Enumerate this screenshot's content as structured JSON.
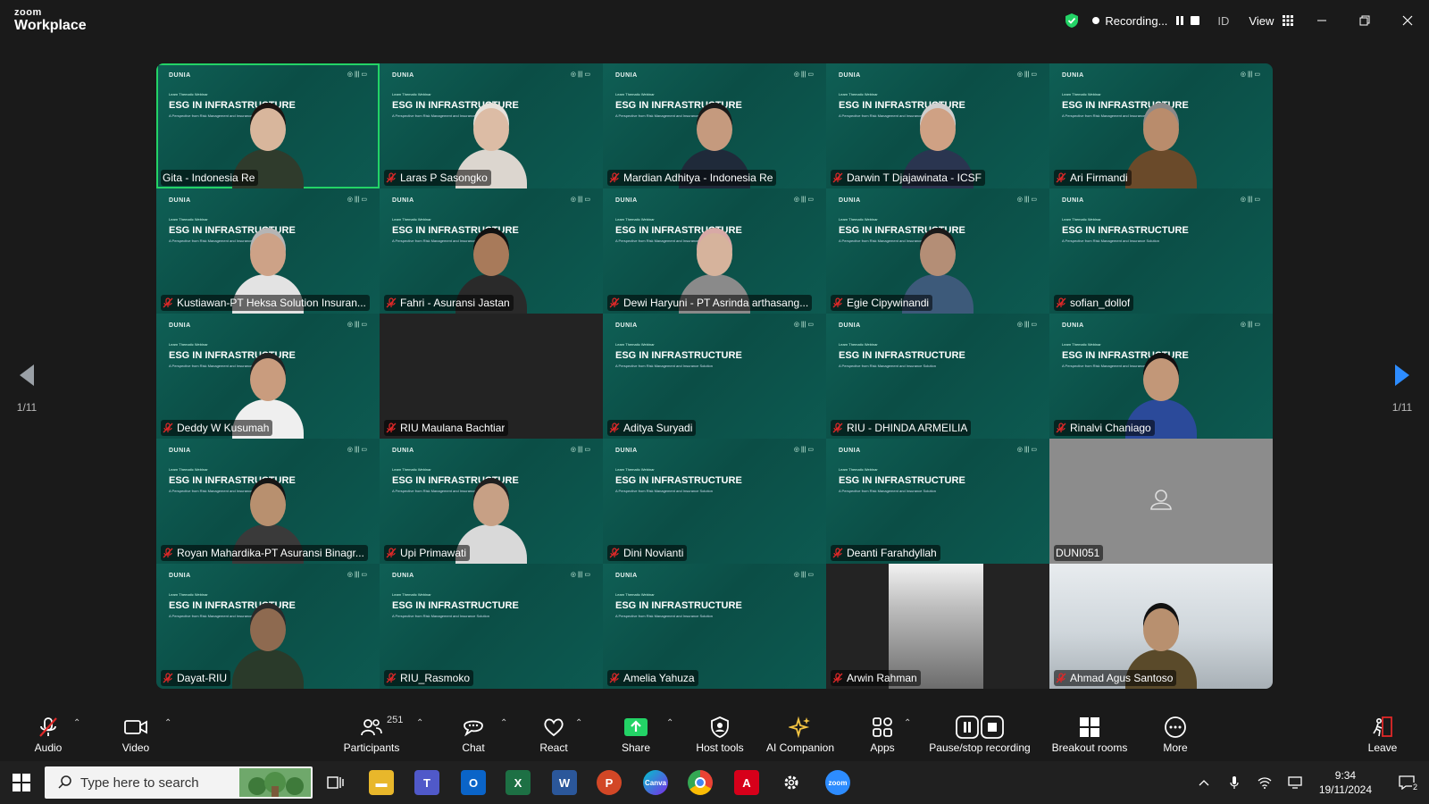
{
  "window": {
    "brand_top": "zoom",
    "brand_bottom": "Workplace",
    "recording_label": "Recording...",
    "id_label": "ID",
    "view_label": "View"
  },
  "gallery": {
    "page_left": "1/11",
    "page_right": "1/11"
  },
  "slide": {
    "brand": "DUNIA",
    "logos": "◎ ||| ▭",
    "kicker": "Learn Thematic Webinar",
    "title": "ESG IN INFRASTRUCTURE",
    "subtitle": "A Perspective from Risk Management and Insurance Solution"
  },
  "participants": [
    {
      "name": "Gita - Indonesia Re",
      "muted": false
    },
    {
      "name": "Laras P Sasongko",
      "muted": true
    },
    {
      "name": "Mardian Adhitya - Indonesia Re",
      "muted": true
    },
    {
      "name": "Darwin T Djajawinata - ICSF",
      "muted": true
    },
    {
      "name": "Ari Firmandi",
      "muted": true
    },
    {
      "name": "Kustiawan-PT Heksa Solution Insuran...",
      "muted": true
    },
    {
      "name": "Fahri - Asuransi Jastan",
      "muted": true
    },
    {
      "name": "Dewi Haryuni - PT Asrinda arthasang...",
      "muted": true
    },
    {
      "name": "Egie Cipywinandi",
      "muted": true
    },
    {
      "name": "sofian_dollof",
      "muted": true
    },
    {
      "name": "Deddy W Kusumah",
      "muted": true
    },
    {
      "name": "RIU Maulana Bachtiar",
      "muted": true
    },
    {
      "name": "Aditya Suryadi",
      "muted": true
    },
    {
      "name": "RIU - DHINDA ARMEILIA",
      "muted": true
    },
    {
      "name": "Rinalvi Chaniago",
      "muted": true
    },
    {
      "name": "Royan Mahardika-PT Asuransi Binagr...",
      "muted": true
    },
    {
      "name": "Upi Primawati",
      "muted": true
    },
    {
      "name": "Dini Novianti",
      "muted": true
    },
    {
      "name": "Deanti Farahdyllah",
      "muted": true
    },
    {
      "name": "DUNI051",
      "muted": false
    },
    {
      "name": "Dayat-RIU",
      "muted": true
    },
    {
      "name": "RIU_Rasmoko",
      "muted": true
    },
    {
      "name": "Amelia Yahuza",
      "muted": true
    },
    {
      "name": "Arwin Rahman",
      "muted": true
    },
    {
      "name": "Ahmad Agus Santoso",
      "muted": true
    }
  ],
  "toolbar": {
    "audio": "Audio",
    "video": "Video",
    "participants": "Participants",
    "participants_count": "251",
    "chat": "Chat",
    "react": "React",
    "share": "Share",
    "host_tools": "Host tools",
    "ai_companion": "AI Companion",
    "apps": "Apps",
    "pause_recording": "Pause/stop recording",
    "breakout": "Breakout rooms",
    "more": "More",
    "leave": "Leave"
  },
  "taskbar": {
    "search_placeholder": "Type here to search",
    "time": "9:34",
    "date": "19/11/2024",
    "notification_count": "2"
  },
  "colors": {
    "active_speaker": "#23d366",
    "share_green": "#23d366",
    "leave_red": "#e02828",
    "slide_teal": "#0d5a51"
  }
}
